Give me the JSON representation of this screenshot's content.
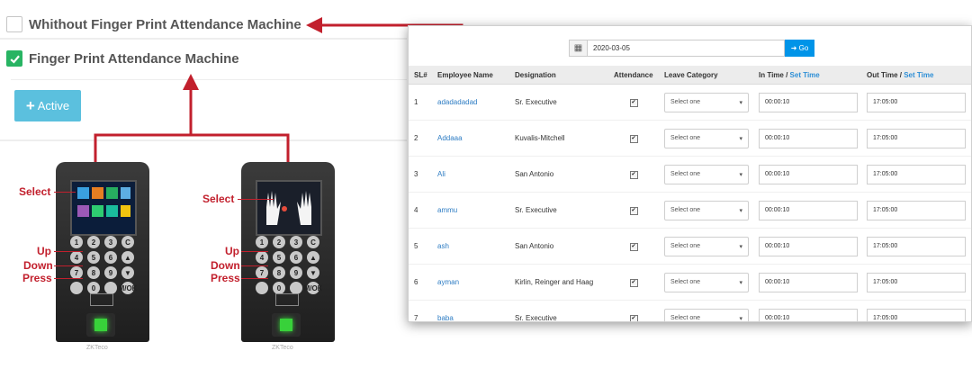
{
  "options": [
    {
      "label": "Whithout Finger Print Attendance Machine",
      "checked": false
    },
    {
      "label": "Finger Print Attendance Machine",
      "checked": true
    }
  ],
  "active_button": {
    "icon": "plus-icon",
    "label": "Active"
  },
  "device_labels": {
    "select": "Select",
    "up": "Up",
    "down": "Down",
    "press": "Press"
  },
  "device": {
    "brand": "ZKTeco",
    "keys": [
      "1",
      "2",
      "3",
      "C",
      "4",
      "5",
      "6",
      "▲",
      "7",
      "8",
      "9",
      "▼",
      "",
      "0",
      "",
      "M/OK"
    ]
  },
  "attendance": {
    "date": "2020-03-05",
    "go_label": "Go",
    "columns": {
      "sl": "SL#",
      "name": "Employee Name",
      "designation": "Designation",
      "attendance": "Attendance",
      "leave": "Leave Category",
      "in_time": "In Time",
      "out_time": "Out Time",
      "set_time": "Set Time"
    },
    "rows": [
      {
        "sl": "1",
        "name": "adadadadad",
        "designation": "Sr. Executive",
        "leave": "Select one",
        "in": "00:00:10",
        "out": "17:05:00"
      },
      {
        "sl": "2",
        "name": "Addaaa",
        "designation": "Kuvalis-Mitchell",
        "leave": "Select one",
        "in": "00:00:10",
        "out": "17:05:00"
      },
      {
        "sl": "3",
        "name": "Ali",
        "designation": "San Antonio",
        "leave": "Select one",
        "in": "00:00:10",
        "out": "17:05:00"
      },
      {
        "sl": "4",
        "name": "ammu",
        "designation": "Sr. Executive",
        "leave": "Select one",
        "in": "00:00:10",
        "out": "17:05:00"
      },
      {
        "sl": "5",
        "name": "ash",
        "designation": "San Antonio",
        "leave": "Select one",
        "in": "00:00:10",
        "out": "17:05:00"
      },
      {
        "sl": "6",
        "name": "ayman",
        "designation": "Kirlin, Reinger and Haag",
        "leave": "Select one",
        "in": "00:00:10",
        "out": "17:05:00"
      },
      {
        "sl": "7",
        "name": "baba",
        "designation": "Sr. Executive",
        "leave": "Select one",
        "in": "00:00:10",
        "out": "17:05:00"
      }
    ]
  },
  "colors": {
    "accent_red": "#c2202d",
    "check_green": "#28b463",
    "btn_blue": "#5bc0de",
    "go_blue": "#0094e8",
    "link_blue": "#2e7dc4"
  }
}
